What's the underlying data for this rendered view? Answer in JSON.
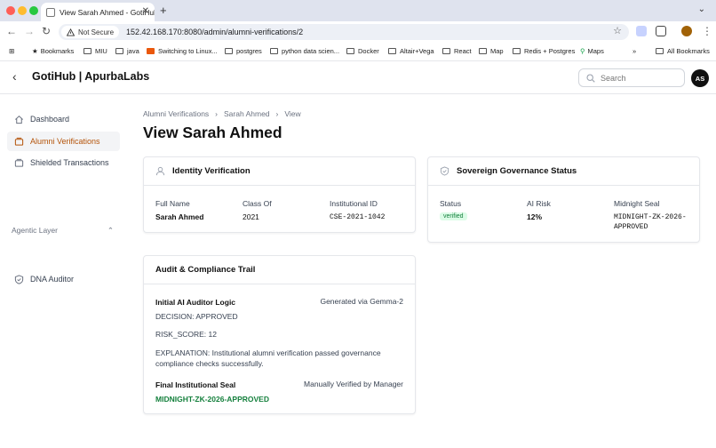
{
  "browser": {
    "tab_title": "View Sarah Ahmed - GotiHub",
    "security_label": "Not Secure",
    "url": "152.42.168.170:8080/admin/alumni-verifications/2",
    "bookmarks": [
      "Bookmarks",
      "MIU",
      "java",
      "Switching to Linux...",
      "postgres",
      "python data scien...",
      "Docker",
      "Altair+Vega",
      "React",
      "Map",
      "Redis + Postgres",
      "Maps"
    ],
    "all_bookmarks": "All Bookmarks"
  },
  "header": {
    "brand": "GotiHub | ApurbaLabs",
    "search_placeholder": "Search",
    "avatar_initials": "AS"
  },
  "sidebar": {
    "items": [
      {
        "label": "Dashboard"
      },
      {
        "label": "Alumni Verifications"
      },
      {
        "label": "Shielded Transactions"
      }
    ],
    "section_label": "Agentic Layer",
    "section_items": [
      {
        "label": "DNA Auditor"
      }
    ]
  },
  "breadcrumb": [
    "Alumni Verifications",
    "Sarah Ahmed",
    "View"
  ],
  "page_title": "View Sarah Ahmed",
  "identity": {
    "title": "Identity Verification",
    "full_name_label": "Full Name",
    "full_name": "Sarah Ahmed",
    "class_label": "Class Of",
    "class_of": "2021",
    "inst_id_label": "Institutional ID",
    "inst_id": "CSE-2021-1042"
  },
  "governance": {
    "title": "Sovereign Governance Status",
    "status_label": "Status",
    "status": "verified",
    "risk_label": "AI Risk",
    "risk": "12%",
    "seal_label": "Midnight Seal",
    "seal_line1": "MIDNIGHT-ZK-2026-",
    "seal_line2": "APPROVED"
  },
  "audit": {
    "title": "Audit & Compliance Trail",
    "initial_label": "Initial AI Auditor Logic",
    "initial_source": "Generated via Gemma-2",
    "decision": "DECISION: APPROVED",
    "risk_score": "RISK_SCORE: 12",
    "explanation": "EXPLANATION: Institutional alumni verification passed governance compliance checks successfully.",
    "final_label": "Final Institutional Seal",
    "final_source": "Manually Verified by Manager",
    "final_seal": "MIDNIGHT-ZK-2026-APPROVED"
  },
  "colors": {
    "accent": "#b45309",
    "success": "#15803d"
  }
}
